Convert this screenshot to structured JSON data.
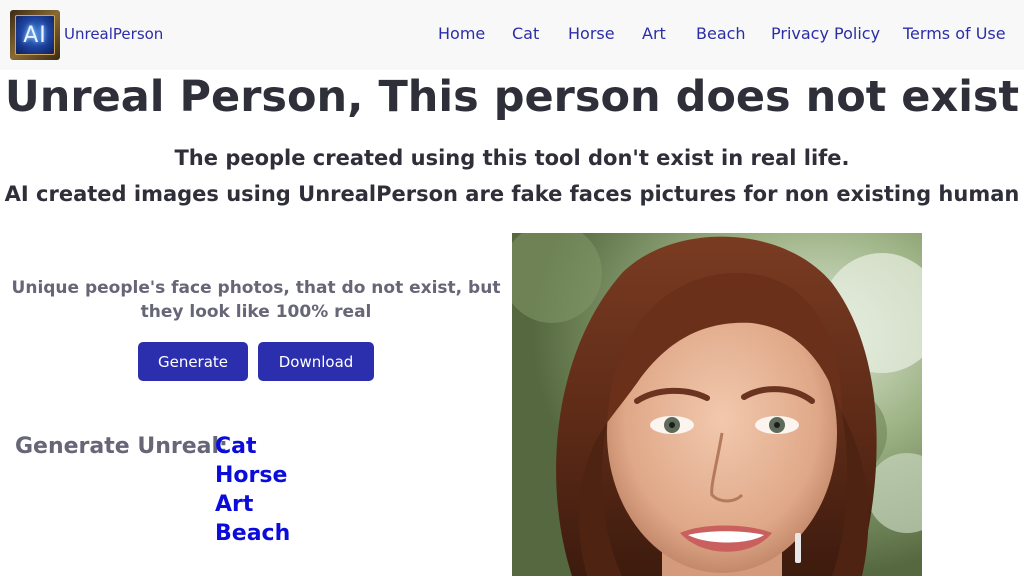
{
  "brand": {
    "name": "UnrealPerson",
    "logo_text": "AI"
  },
  "nav": [
    "Home",
    "Cat",
    "Horse",
    "Art",
    "Beach",
    "Privacy Policy",
    "Terms of Use"
  ],
  "headline": "Unreal Person, This person does not exist",
  "subheadlines": [
    "The people created using this tool don't exist in real life.",
    "AI created images using UnrealPerson are fake faces pictures for non existing human"
  ],
  "tagline": "Unique people's face photos, that do not exist, but they look like 100% real",
  "buttons": {
    "generate": "Generate",
    "download": "Download"
  },
  "generate_unreal": {
    "label": "Generate Unreal:",
    "links": [
      "Cat",
      "Horse",
      "Art",
      "Beach"
    ]
  },
  "colors": {
    "accent": "#2b2fad",
    "link": "#0b0bdc",
    "nav_text": "#2b2ea8",
    "navbar_bg": "#f8f8f8"
  },
  "icons": {
    "logo": "ai-logo-icon"
  }
}
